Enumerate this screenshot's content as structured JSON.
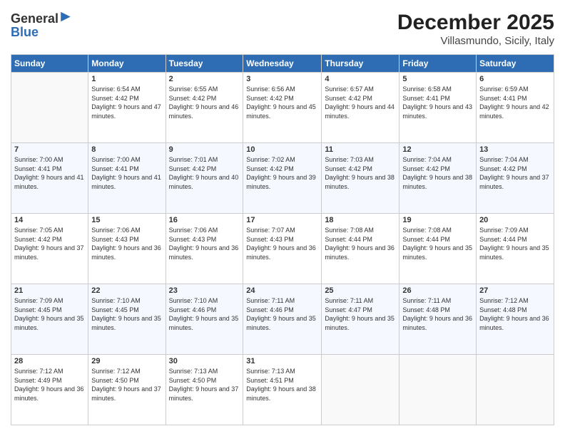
{
  "header": {
    "logo_line1": "General",
    "logo_line2": "Blue",
    "month_year": "December 2025",
    "location": "Villasmundo, Sicily, Italy"
  },
  "days_of_week": [
    "Sunday",
    "Monday",
    "Tuesday",
    "Wednesday",
    "Thursday",
    "Friday",
    "Saturday"
  ],
  "weeks": [
    [
      {
        "day": "",
        "sunrise": "",
        "sunset": "",
        "daylight": ""
      },
      {
        "day": "1",
        "sunrise": "Sunrise: 6:54 AM",
        "sunset": "Sunset: 4:42 PM",
        "daylight": "Daylight: 9 hours and 47 minutes."
      },
      {
        "day": "2",
        "sunrise": "Sunrise: 6:55 AM",
        "sunset": "Sunset: 4:42 PM",
        "daylight": "Daylight: 9 hours and 46 minutes."
      },
      {
        "day": "3",
        "sunrise": "Sunrise: 6:56 AM",
        "sunset": "Sunset: 4:42 PM",
        "daylight": "Daylight: 9 hours and 45 minutes."
      },
      {
        "day": "4",
        "sunrise": "Sunrise: 6:57 AM",
        "sunset": "Sunset: 4:42 PM",
        "daylight": "Daylight: 9 hours and 44 minutes."
      },
      {
        "day": "5",
        "sunrise": "Sunrise: 6:58 AM",
        "sunset": "Sunset: 4:41 PM",
        "daylight": "Daylight: 9 hours and 43 minutes."
      },
      {
        "day": "6",
        "sunrise": "Sunrise: 6:59 AM",
        "sunset": "Sunset: 4:41 PM",
        "daylight": "Daylight: 9 hours and 42 minutes."
      }
    ],
    [
      {
        "day": "7",
        "sunrise": "Sunrise: 7:00 AM",
        "sunset": "Sunset: 4:41 PM",
        "daylight": "Daylight: 9 hours and 41 minutes."
      },
      {
        "day": "8",
        "sunrise": "Sunrise: 7:00 AM",
        "sunset": "Sunset: 4:41 PM",
        "daylight": "Daylight: 9 hours and 41 minutes."
      },
      {
        "day": "9",
        "sunrise": "Sunrise: 7:01 AM",
        "sunset": "Sunset: 4:42 PM",
        "daylight": "Daylight: 9 hours and 40 minutes."
      },
      {
        "day": "10",
        "sunrise": "Sunrise: 7:02 AM",
        "sunset": "Sunset: 4:42 PM",
        "daylight": "Daylight: 9 hours and 39 minutes."
      },
      {
        "day": "11",
        "sunrise": "Sunrise: 7:03 AM",
        "sunset": "Sunset: 4:42 PM",
        "daylight": "Daylight: 9 hours and 38 minutes."
      },
      {
        "day": "12",
        "sunrise": "Sunrise: 7:04 AM",
        "sunset": "Sunset: 4:42 PM",
        "daylight": "Daylight: 9 hours and 38 minutes."
      },
      {
        "day": "13",
        "sunrise": "Sunrise: 7:04 AM",
        "sunset": "Sunset: 4:42 PM",
        "daylight": "Daylight: 9 hours and 37 minutes."
      }
    ],
    [
      {
        "day": "14",
        "sunrise": "Sunrise: 7:05 AM",
        "sunset": "Sunset: 4:42 PM",
        "daylight": "Daylight: 9 hours and 37 minutes."
      },
      {
        "day": "15",
        "sunrise": "Sunrise: 7:06 AM",
        "sunset": "Sunset: 4:43 PM",
        "daylight": "Daylight: 9 hours and 36 minutes."
      },
      {
        "day": "16",
        "sunrise": "Sunrise: 7:06 AM",
        "sunset": "Sunset: 4:43 PM",
        "daylight": "Daylight: 9 hours and 36 minutes."
      },
      {
        "day": "17",
        "sunrise": "Sunrise: 7:07 AM",
        "sunset": "Sunset: 4:43 PM",
        "daylight": "Daylight: 9 hours and 36 minutes."
      },
      {
        "day": "18",
        "sunrise": "Sunrise: 7:08 AM",
        "sunset": "Sunset: 4:44 PM",
        "daylight": "Daylight: 9 hours and 36 minutes."
      },
      {
        "day": "19",
        "sunrise": "Sunrise: 7:08 AM",
        "sunset": "Sunset: 4:44 PM",
        "daylight": "Daylight: 9 hours and 35 minutes."
      },
      {
        "day": "20",
        "sunrise": "Sunrise: 7:09 AM",
        "sunset": "Sunset: 4:44 PM",
        "daylight": "Daylight: 9 hours and 35 minutes."
      }
    ],
    [
      {
        "day": "21",
        "sunrise": "Sunrise: 7:09 AM",
        "sunset": "Sunset: 4:45 PM",
        "daylight": "Daylight: 9 hours and 35 minutes."
      },
      {
        "day": "22",
        "sunrise": "Sunrise: 7:10 AM",
        "sunset": "Sunset: 4:45 PM",
        "daylight": "Daylight: 9 hours and 35 minutes."
      },
      {
        "day": "23",
        "sunrise": "Sunrise: 7:10 AM",
        "sunset": "Sunset: 4:46 PM",
        "daylight": "Daylight: 9 hours and 35 minutes."
      },
      {
        "day": "24",
        "sunrise": "Sunrise: 7:11 AM",
        "sunset": "Sunset: 4:46 PM",
        "daylight": "Daylight: 9 hours and 35 minutes."
      },
      {
        "day": "25",
        "sunrise": "Sunrise: 7:11 AM",
        "sunset": "Sunset: 4:47 PM",
        "daylight": "Daylight: 9 hours and 35 minutes."
      },
      {
        "day": "26",
        "sunrise": "Sunrise: 7:11 AM",
        "sunset": "Sunset: 4:48 PM",
        "daylight": "Daylight: 9 hours and 36 minutes."
      },
      {
        "day": "27",
        "sunrise": "Sunrise: 7:12 AM",
        "sunset": "Sunset: 4:48 PM",
        "daylight": "Daylight: 9 hours and 36 minutes."
      }
    ],
    [
      {
        "day": "28",
        "sunrise": "Sunrise: 7:12 AM",
        "sunset": "Sunset: 4:49 PM",
        "daylight": "Daylight: 9 hours and 36 minutes."
      },
      {
        "day": "29",
        "sunrise": "Sunrise: 7:12 AM",
        "sunset": "Sunset: 4:50 PM",
        "daylight": "Daylight: 9 hours and 37 minutes."
      },
      {
        "day": "30",
        "sunrise": "Sunrise: 7:13 AM",
        "sunset": "Sunset: 4:50 PM",
        "daylight": "Daylight: 9 hours and 37 minutes."
      },
      {
        "day": "31",
        "sunrise": "Sunrise: 7:13 AM",
        "sunset": "Sunset: 4:51 PM",
        "daylight": "Daylight: 9 hours and 38 minutes."
      },
      {
        "day": "",
        "sunrise": "",
        "sunset": "",
        "daylight": ""
      },
      {
        "day": "",
        "sunrise": "",
        "sunset": "",
        "daylight": ""
      },
      {
        "day": "",
        "sunrise": "",
        "sunset": "",
        "daylight": ""
      }
    ]
  ]
}
